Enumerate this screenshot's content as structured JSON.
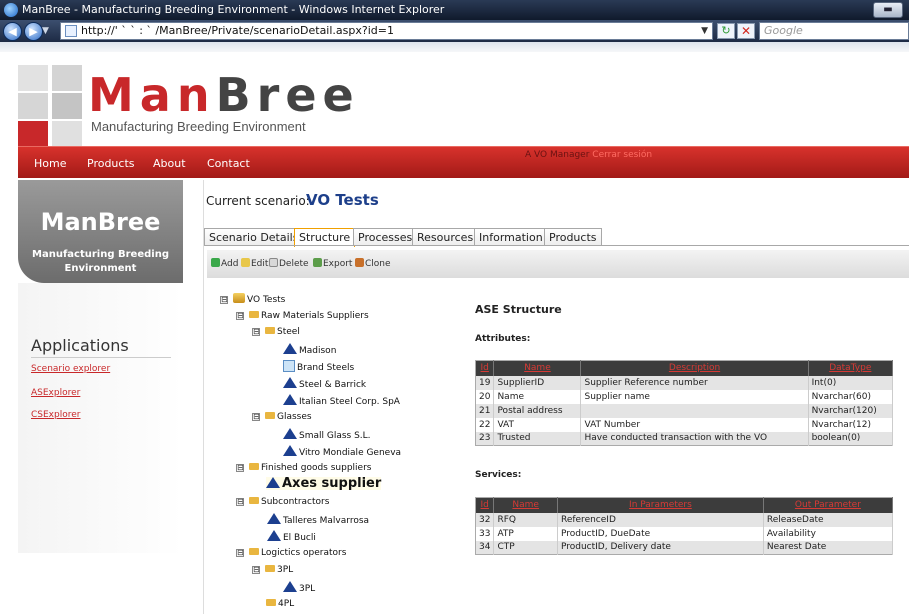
{
  "browser": {
    "window_title": "ManBree - Manufacturing Breeding Environment - Windows Internet Explorer",
    "url": "http://' ` ` : ` /ManBree/Private/scenarioDetail.aspx?id=1",
    "search_placeholder": "Google",
    "back_icon": "back-arrow-icon",
    "forward_icon": "forward-arrow-icon"
  },
  "header": {
    "brand_first": "Man",
    "brand_second": "Bree",
    "tagline": "Manufacturing Breeding Environment",
    "colors": {
      "accent": "#c8282a",
      "dark": "#444444"
    }
  },
  "nav": {
    "items": [
      {
        "label": "Home"
      },
      {
        "label": "Products"
      },
      {
        "label": "About"
      },
      {
        "label": "Contact"
      }
    ],
    "user_prefix": "A VO Manager",
    "logout_label": "Cerrar sesión"
  },
  "sidebar": {
    "title": "ManBree",
    "subtitle": "Manufacturing Breeding Environment",
    "apps_heading": "Applications",
    "apps": [
      {
        "label": "Scenario explorer"
      },
      {
        "label": "ASExplorer"
      },
      {
        "label": "CSExplorer"
      }
    ]
  },
  "main": {
    "current_label": "Current scenario:",
    "current_value": "VO Tests",
    "tabs": [
      {
        "label": "Scenario Details"
      },
      {
        "label": "Structure",
        "active": true
      },
      {
        "label": "Processes"
      },
      {
        "label": "Resources"
      },
      {
        "label": "Information"
      },
      {
        "label": "Products"
      }
    ],
    "toolbar": [
      {
        "label": "Add",
        "icon": "add-icon"
      },
      {
        "label": "Edit",
        "icon": "edit-icon"
      },
      {
        "label": "Delete",
        "icon": "delete-icon"
      },
      {
        "label": "Export",
        "icon": "export-icon"
      },
      {
        "label": "Clone",
        "icon": "clone-icon"
      }
    ]
  },
  "tree": [
    {
      "label": "VO Tests",
      "toggle": "⊟"
    },
    {
      "label": "Raw Materials Suppliers",
      "toggle": "⊟"
    },
    {
      "label": "Steel",
      "toggle": "⊟"
    },
    {
      "label": "Madison"
    },
    {
      "label": "Brand Steels"
    },
    {
      "label": "Steel & Barrick"
    },
    {
      "label": "Italian Steel Corp. SpA"
    },
    {
      "label": "Glasses",
      "toggle": "⊟"
    },
    {
      "label": "Small Glass S.L."
    },
    {
      "label": "Vitro Mondiale Geneva"
    },
    {
      "label": "Finished goods suppliers",
      "toggle": "⊟"
    },
    {
      "label": "Axes supplier"
    },
    {
      "label": "Subcontractors",
      "toggle": "⊟"
    },
    {
      "label": "Talleres Malvarrosa"
    },
    {
      "label": "El Bucli"
    },
    {
      "label": "Logictics operators",
      "toggle": "⊟"
    },
    {
      "label": "3PL",
      "toggle": "⊟"
    },
    {
      "label": "3PL"
    },
    {
      "label": "4PL"
    }
  ],
  "structure": {
    "title": "ASE Structure",
    "attributes_heading": "Attributes:",
    "attributes_columns": [
      "Id",
      "Name",
      "Description",
      "DataType"
    ],
    "attributes_rows": [
      [
        "19",
        "SupplierID",
        "Supplier Reference number",
        "Int(0)"
      ],
      [
        "20",
        "Name",
        "Supplier name",
        "Nvarchar(60)"
      ],
      [
        "21",
        "Postal address",
        "",
        "Nvarchar(120)"
      ],
      [
        "22",
        "VAT",
        "VAT Number",
        "Nvarchar(12)"
      ],
      [
        "23",
        "Trusted",
        "Have conducted transaction with the VO",
        "boolean(0)"
      ]
    ],
    "services_heading": "Services:",
    "services_columns": [
      "Id",
      "Name",
      "In Parameters",
      "Out Parameter"
    ],
    "services_rows": [
      [
        "32",
        "RFQ",
        "ReferenceID",
        "ReleaseDate"
      ],
      [
        "33",
        "ATP",
        "ProductID, DueDate",
        "Availability"
      ],
      [
        "34",
        "CTP",
        "ProductID, Delivery date",
        "Nearest Date"
      ]
    ]
  }
}
